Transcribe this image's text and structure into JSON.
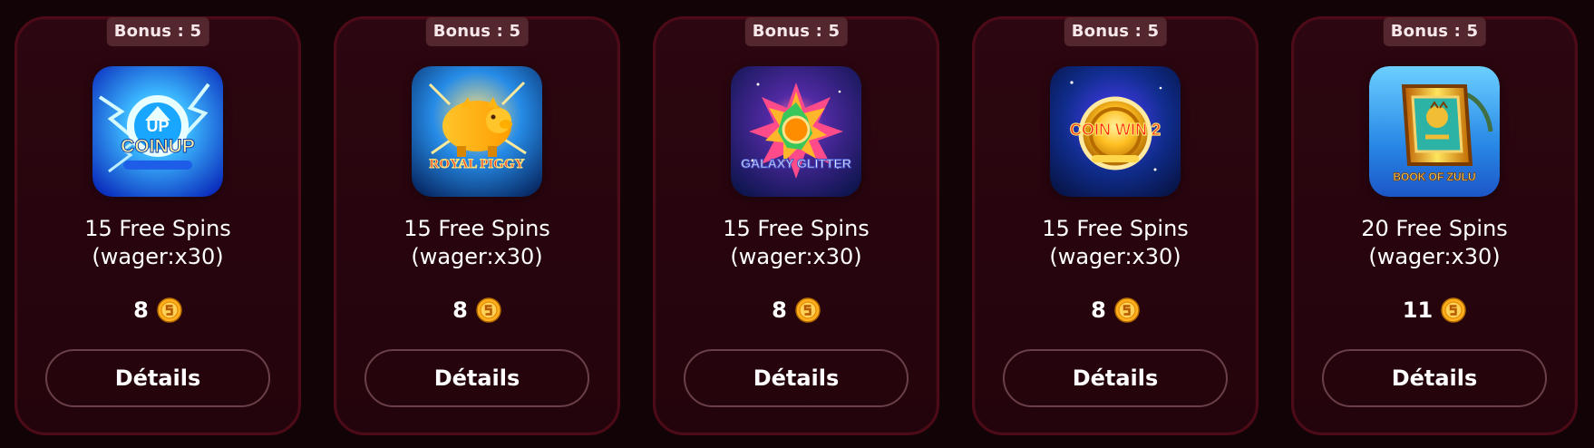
{
  "cards": [
    {
      "bonus_label": "Bonus : 5",
      "game_art_text": "COINUP",
      "offer_line_1": "15 Free Spins",
      "offer_line_2": "(wager:x30)",
      "price": "8",
      "details_label": "Détails",
      "icon_name": "coin-up-lightning-game-icon"
    },
    {
      "bonus_label": "Bonus : 5",
      "game_art_text": "ROYAL PIGGY",
      "offer_line_1": "15 Free Spins",
      "offer_line_2": "(wager:x30)",
      "price": "8",
      "details_label": "Détails",
      "icon_name": "royal-piggy-game-icon"
    },
    {
      "bonus_label": "Bonus : 5",
      "game_art_text": "GALAXY GLITTER",
      "offer_line_1": "15 Free Spins",
      "offer_line_2": "(wager:x30)",
      "price": "8",
      "details_label": "Détails",
      "icon_name": "galaxy-glitter-game-icon"
    },
    {
      "bonus_label": "Bonus : 5",
      "game_art_text": "COIN WIN 2",
      "offer_line_1": "15 Free Spins",
      "offer_line_2": "(wager:x30)",
      "price": "8",
      "details_label": "Détails",
      "icon_name": "coin-win-2-game-icon"
    },
    {
      "bonus_label": "Bonus : 5",
      "game_art_text": "BOOK OF ZULU",
      "offer_line_1": "20 Free Spins",
      "offer_line_2": "(wager:x30)",
      "price": "11",
      "details_label": "Détails",
      "icon_name": "book-of-zulu-game-icon"
    }
  ],
  "coin_icon_name": "gold-coin-icon",
  "colors": {
    "background": "#120307",
    "card_background": "#2c0610",
    "card_border": "#4e0b17",
    "badge_background": "#54262d",
    "button_border": "#6a4048",
    "coin": "#ffb020"
  }
}
